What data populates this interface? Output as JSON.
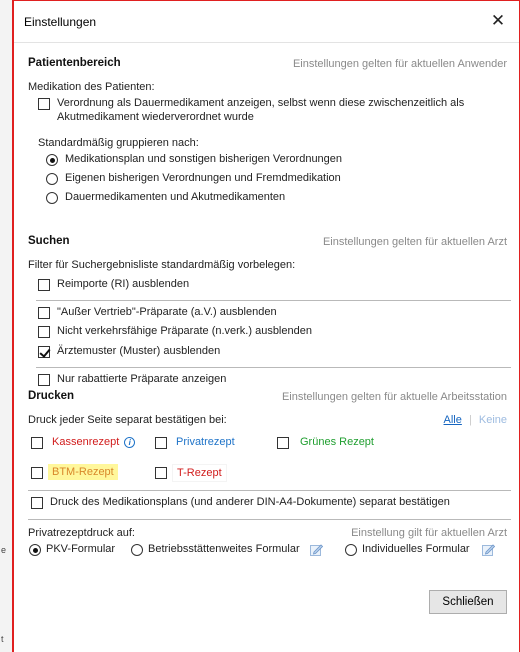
{
  "window": {
    "title": "Einstellungen",
    "close_glyph": "✕"
  },
  "patient": {
    "title": "Patientenbereich",
    "note": "Einstellungen gelten für aktuellen Anwender",
    "medication_label": "Medikation des Patienten:",
    "dauer_line1": "Verordnung als Dauermedikament anzeigen, selbst wenn diese zwischenzeitlich als",
    "dauer_line2": "Akutmedikament wiederverordnet wurde",
    "dauer_checked": false,
    "group_label": "Standardmäßig gruppieren nach:",
    "group_options": [
      {
        "label": "Medikationsplan und sonstigen bisherigen Verordnungen",
        "checked": true
      },
      {
        "label": "Eigenen bisherigen Verordnungen und Fremdmedikation",
        "checked": false
      },
      {
        "label": "Dauermedikamenten und Akutmedikamenten",
        "checked": false
      }
    ]
  },
  "search": {
    "title": "Suchen",
    "note": "Einstellungen gelten für aktuellen Arzt",
    "filter_label": "Filter für Suchergebnisliste standardmäßig vorbelegen:",
    "options": [
      {
        "label": "Reimporte (RI) ausblenden",
        "checked": false
      },
      {
        "label": "\"Außer Vertrieb\"-Präparate (a.V.) ausblenden",
        "checked": false
      },
      {
        "label": "Nicht verkehrsfähige Präparate (n.verk.) ausblenden",
        "checked": false
      },
      {
        "label": "Ärztemuster (Muster) ausblenden",
        "checked": true
      },
      {
        "label": "Nur rabattierte Präparate anzeigen",
        "checked": false
      }
    ]
  },
  "print": {
    "title": "Drucken",
    "note": "Einstellungen gelten für aktuelle Arbeitsstation",
    "confirm_label": "Druck jeder Seite separat bestätigen bei:",
    "all_link": "Alle",
    "pipe": "|",
    "none_link": "Keine",
    "prescriptions": [
      {
        "label": "Kassenrezept",
        "checked": false,
        "color": "#d11c1c"
      },
      {
        "label": "Privatrezept",
        "checked": false,
        "color": "#1e73c8"
      },
      {
        "label": "Grünes Rezept",
        "checked": false,
        "color": "#1f9e2f"
      },
      {
        "label": "BTM-Rezept",
        "checked": false,
        "color": "#d8872a"
      },
      {
        "label": "T-Rezept",
        "checked": false,
        "color": "#d11c1c"
      }
    ],
    "info_icon": "i",
    "medplan_label": "Druck des Medikationsplans (und anderer DIN-A4-Dokumente) separat bestätigen",
    "medplan_checked": false,
    "private_label": "Privatrezeptdruck auf:",
    "private_note": "Einstellung gilt für aktuellen Arzt",
    "private_options": [
      {
        "label": "PKV-Formular",
        "checked": true
      },
      {
        "label": "Betriebsstättenweites Formular",
        "checked": false
      },
      {
        "label": "Individuelles Formular",
        "checked": false
      }
    ]
  },
  "footer": {
    "close_button": "Schließen"
  },
  "background": {
    "mark_a": "e",
    "mark_b": "t"
  },
  "icons": {
    "close": "close-icon",
    "info": "info-icon",
    "edit": "edit-icon"
  }
}
